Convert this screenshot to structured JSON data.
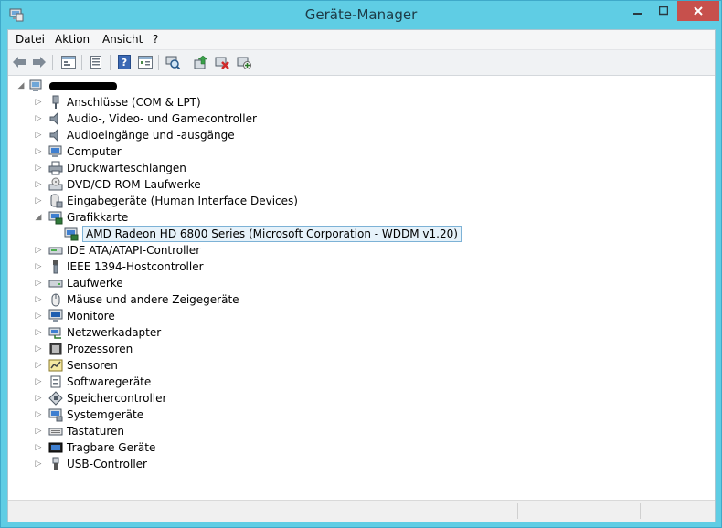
{
  "window": {
    "title": "Geräte-Manager"
  },
  "menu": {
    "items": [
      "Datei",
      "Aktion",
      "Ansicht",
      "?"
    ]
  },
  "toolbar": {
    "buttons": [
      "back-icon",
      "forward-icon",
      "up-level-icon",
      "show-hide-tree-icon",
      "help-icon",
      "properties-icon",
      "scan-hardware-icon",
      "update-driver-icon",
      "disable-device-icon",
      "uninstall-device-icon"
    ]
  },
  "tree": {
    "root": {
      "label": ""
    },
    "categories": [
      {
        "label": "Anschlüsse (COM & LPT)",
        "icon": "port-icon"
      },
      {
        "label": "Audio-, Video- und Gamecontroller",
        "icon": "speaker-icon"
      },
      {
        "label": "Audioeingänge und -ausgänge",
        "icon": "speaker-icon"
      },
      {
        "label": "Computer",
        "icon": "computer-icon"
      },
      {
        "label": "Druckwarteschlangen",
        "icon": "printer-icon"
      },
      {
        "label": "DVD/CD-ROM-Laufwerke",
        "icon": "dvd-drive-icon"
      },
      {
        "label": "Eingabegeräte (Human Interface Devices)",
        "icon": "hid-icon"
      },
      {
        "label": "Grafikkarte",
        "icon": "display-adapter-icon",
        "expanded": true,
        "children": [
          {
            "label": "AMD Radeon HD 6800 Series (Microsoft Corporation - WDDM v1.20)",
            "icon": "display-adapter-icon",
            "selected": true
          }
        ]
      },
      {
        "label": "IDE ATA/ATAPI-Controller",
        "icon": "ide-controller-icon"
      },
      {
        "label": "IEEE 1394-Hostcontroller",
        "icon": "firewire-icon"
      },
      {
        "label": "Laufwerke",
        "icon": "disk-drive-icon"
      },
      {
        "label": "Mäuse und andere Zeigegeräte",
        "icon": "mouse-icon"
      },
      {
        "label": "Monitore",
        "icon": "monitor-icon"
      },
      {
        "label": "Netzwerkadapter",
        "icon": "network-adapter-icon"
      },
      {
        "label": "Prozessoren",
        "icon": "processor-icon"
      },
      {
        "label": "Sensoren",
        "icon": "sensor-icon"
      },
      {
        "label": "Softwaregeräte",
        "icon": "software-device-icon"
      },
      {
        "label": "Speichercontroller",
        "icon": "storage-controller-icon"
      },
      {
        "label": "Systemgeräte",
        "icon": "system-device-icon"
      },
      {
        "label": "Tastaturen",
        "icon": "keyboard-icon"
      },
      {
        "label": "Tragbare Geräte",
        "icon": "portable-device-icon"
      },
      {
        "label": "USB-Controller",
        "icon": "usb-icon"
      }
    ]
  },
  "colors": {
    "titlebar": "#5fcde4",
    "close": "#c7504c",
    "selection_bg": "#e6f2fa",
    "selection_border": "#7db2d6"
  }
}
